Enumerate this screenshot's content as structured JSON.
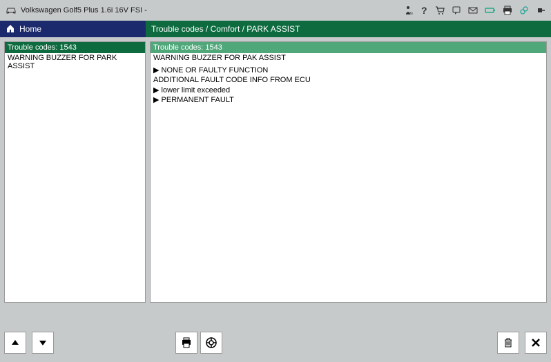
{
  "topbar": {
    "vehicle": "Volkswagen Golf5 Plus 1.6i 16V FSI -"
  },
  "nav": {
    "home": "Home",
    "path": "Trouble codes / Comfort / PARK ASSIST"
  },
  "leftPanel": {
    "header": "Trouble codes: 1543",
    "sub": "WARNING BUZZER FOR PARK ASSIST"
  },
  "rightPanel": {
    "header": "Trouble codes: 1543",
    "sub": "WARNING BUZZER FOR PAK ASSIST",
    "lines": [
      "",
      "▶ NONE OR FAULTY FUNCTION",
      "ADDITIONAL FAULT CODE INFO FROM ECU",
      "▶ lower limit exceeded",
      "▶ PERMANENT FAULT"
    ]
  }
}
